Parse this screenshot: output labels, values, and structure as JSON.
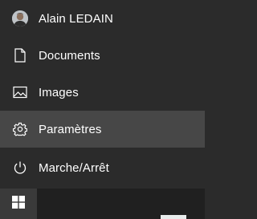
{
  "user": {
    "name": "Alain LEDAIN",
    "icon": "user-avatar"
  },
  "menu": {
    "items": [
      {
        "label": "Documents",
        "icon": "document-icon"
      },
      {
        "label": "Images",
        "icon": "image-icon"
      },
      {
        "label": "Paramètres",
        "icon": "gear-icon",
        "active": true
      },
      {
        "label": "Marche/Arrêt",
        "icon": "power-icon"
      }
    ]
  },
  "taskbar": {
    "start_icon": "windows-logo-icon"
  },
  "colors": {
    "menu_background": "#2b2b2b",
    "hover_background": "#474747",
    "taskbar_background": "#202020",
    "text": "#ffffff"
  }
}
